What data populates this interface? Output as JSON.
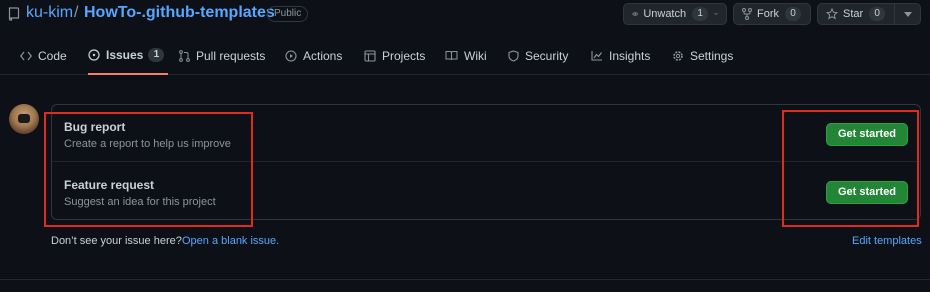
{
  "repo": {
    "owner": "ku-kim",
    "separator": "/",
    "name": "HowTo-.github-templates",
    "visibility": "Public"
  },
  "actions": {
    "watch_label": "Unwatch",
    "watch_count": "1",
    "fork_label": "Fork",
    "fork_count": "0",
    "star_label": "Star",
    "star_count": "0"
  },
  "tabs": [
    {
      "label": "Code",
      "icon": "code-icon"
    },
    {
      "label": "Issues",
      "icon": "issue-opened-icon",
      "count": "1",
      "active": true
    },
    {
      "label": "Pull requests",
      "icon": "pull-request-icon"
    },
    {
      "label": "Actions",
      "icon": "play-icon"
    },
    {
      "label": "Projects",
      "icon": "table-icon"
    },
    {
      "label": "Wiki",
      "icon": "book-icon"
    },
    {
      "label": "Security",
      "icon": "shield-icon"
    },
    {
      "label": "Insights",
      "icon": "graph-icon"
    },
    {
      "label": "Settings",
      "icon": "gear-icon"
    }
  ],
  "templates": [
    {
      "name": "Bug report",
      "about": "Create a report to help us improve",
      "button": "Get started"
    },
    {
      "name": "Feature request",
      "about": "Suggest an idea for this project",
      "button": "Get started"
    }
  ],
  "footer": {
    "question": "Don’t see your issue here?",
    "blank_link": "Open a blank issue.",
    "edit_link": "Edit templates"
  },
  "colors": {
    "background": "#0d1117",
    "link": "#58a6ff",
    "primary_button": "#238636",
    "active_tab_underline": "#f78166",
    "highlight_box": "#e02c1f"
  }
}
